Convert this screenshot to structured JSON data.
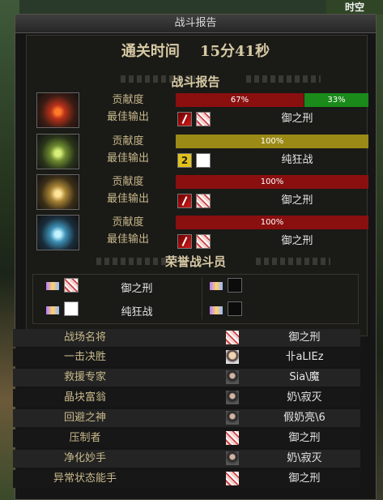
{
  "window": {
    "title": "战斗报告"
  },
  "corner_text": "时空",
  "clear_time": {
    "label": "通关时间",
    "value": "15分41秒"
  },
  "section_battle": "战斗报告",
  "section_honor": "荣誉战斗员",
  "labels": {
    "contribution": "贡献度",
    "best_output": "最佳输出"
  },
  "players": [
    {
      "avatar": "fire-character-icon",
      "bars": [
        {
          "pct": 67,
          "label": "67%",
          "color": "#8a0f0f"
        },
        {
          "pct": 33,
          "label": "33%",
          "color": "#1a8a1a"
        }
      ],
      "output_icon": "red",
      "best": "御之刑"
    },
    {
      "avatar": "green-character-icon",
      "bars": [
        {
          "pct": 100,
          "label": "100%",
          "color": "#9c8a17"
        }
      ],
      "output_icon": "yellow",
      "output_icon_text": "2",
      "best": "纯狂战"
    },
    {
      "avatar": "gold-character-icon",
      "bars": [
        {
          "pct": 100,
          "label": "100%",
          "color": "#8a0f0f"
        }
      ],
      "output_icon": "red",
      "best": "御之刑"
    },
    {
      "avatar": "blue-character-icon",
      "bars": [
        {
          "pct": 100,
          "label": "100%",
          "color": "#8a0f0f"
        }
      ],
      "output_icon": "red",
      "best": "御之刑"
    }
  ],
  "honor": [
    {
      "name": "御之刑"
    },
    {
      "name": "纯狂战"
    }
  ],
  "stats": [
    {
      "title": "战场名将",
      "player": "御之刑"
    },
    {
      "title": "一击决胜",
      "player": "卝aLIEz"
    },
    {
      "title": "救援专家",
      "player": "Sia\\魔"
    },
    {
      "title": "晶块富翁",
      "player": "奶\\寂灭"
    },
    {
      "title": "回避之神",
      "player": "假奶亮\\6"
    },
    {
      "title": "压制者",
      "player": "御之刑"
    },
    {
      "title": "净化妙手",
      "player": "奶\\寂灭"
    },
    {
      "title": "异常状态能手",
      "player": "御之刑"
    }
  ]
}
